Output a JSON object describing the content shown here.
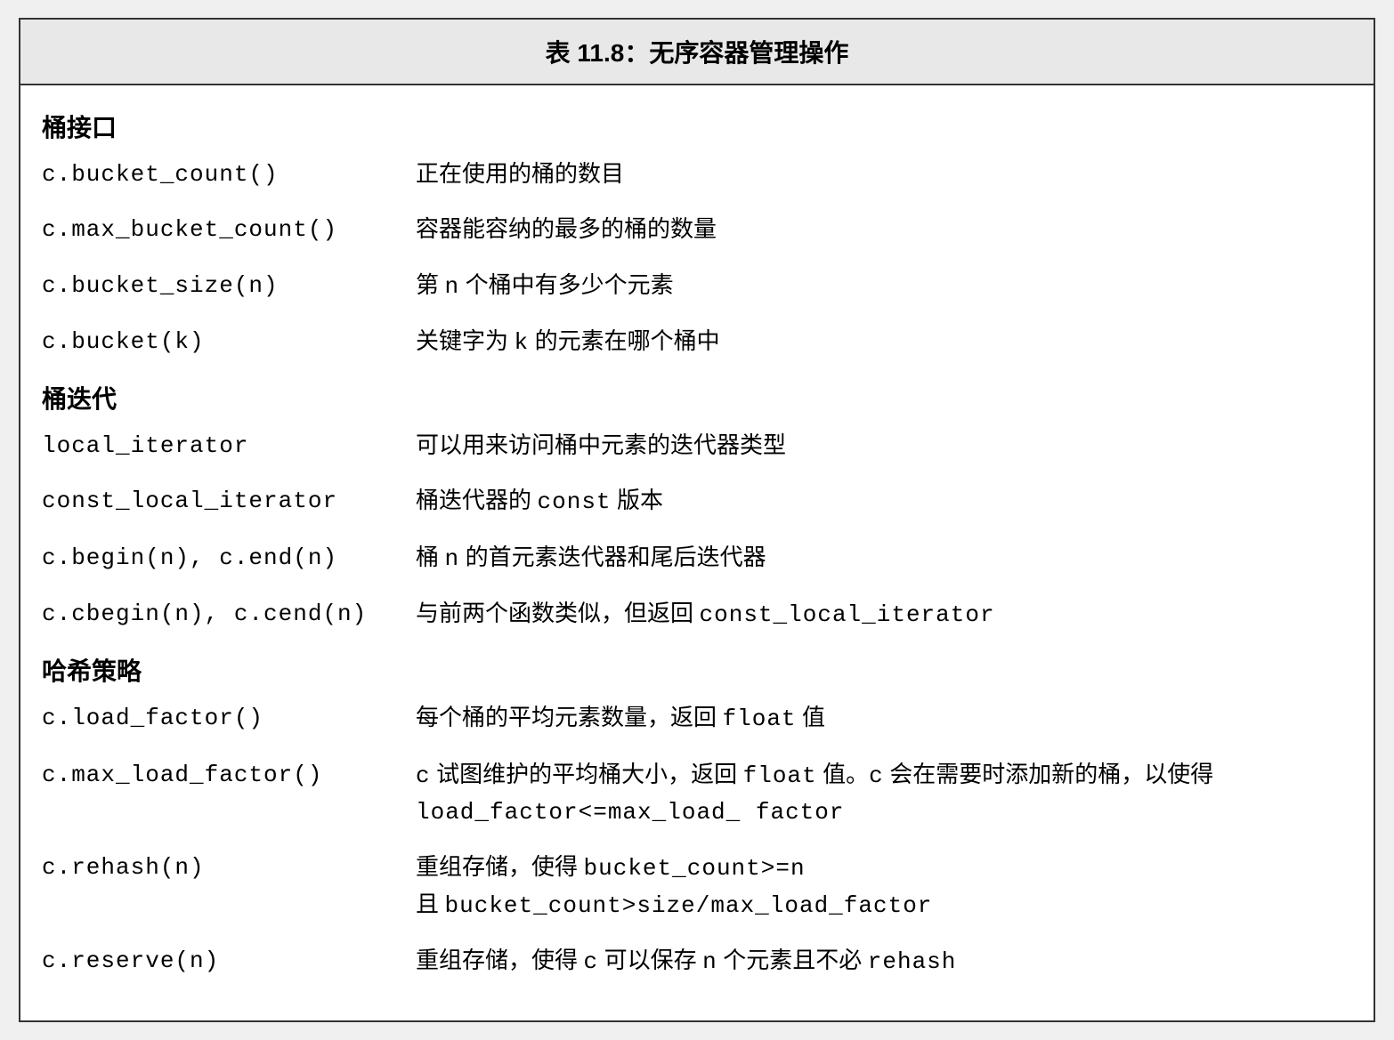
{
  "title": "表 11.8：无序容器管理操作",
  "sections": [
    {
      "header": "桶接口",
      "rows": [
        {
          "left": "c.bucket_count()",
          "right": "正在使用的桶的数目"
        },
        {
          "left": "c.max_bucket_count()",
          "right": "容器能容纳的最多的桶的数量"
        },
        {
          "left": "c.bucket_size(n)",
          "right": "第 <span class=\"mono\">n</span> 个桶中有多少个元素"
        },
        {
          "left": "c.bucket(k)",
          "right": "关键字为 <span class=\"mono\">k</span> 的元素在哪个桶中"
        }
      ]
    },
    {
      "header": "桶迭代",
      "rows": [
        {
          "left": "local_iterator",
          "right": "可以用来访问桶中元素的迭代器类型"
        },
        {
          "left": "const_local_iterator",
          "right": "桶迭代器的 <span class=\"mono\">const</span> 版本"
        },
        {
          "left": "c.begin(n), c.end(n)",
          "right": "桶 <span class=\"mono\">n</span> 的首元素迭代器和尾后迭代器"
        },
        {
          "left": "c.cbegin(n), c.cend(n)",
          "right": "与前两个函数类似，但返回 <span class=\"mono\">const_local_iterator</span>"
        }
      ]
    },
    {
      "header": "哈希策略",
      "rows": [
        {
          "left": "c.load_factor()",
          "right": "每个桶的平均元素数量，返回 <span class=\"mono\">float</span> 值"
        },
        {
          "left": "c.max_load_factor()",
          "right": "<span class=\"mono\">c</span> 试图维护的平均桶大小，返回 <span class=\"mono\">float</span> 值。<span class=\"mono\">c</span> 会在需要时添加新的桶，以使得 <span class=\"mono\">load_factor<=max_load_ factor</span>"
        },
        {
          "left": "c.rehash(n)",
          "right": "重组存储，使得 <span class=\"mono\">bucket_count>=n</span><br>且 <span class=\"mono\">bucket_count>size/max_load_factor</span>"
        },
        {
          "left": "c.reserve(n)",
          "right": "重组存储，使得 <span class=\"mono\">c</span> 可以保存 <span class=\"mono\">n</span> 个元素且不必 <span class=\"mono\">rehash</span>"
        }
      ]
    }
  ]
}
